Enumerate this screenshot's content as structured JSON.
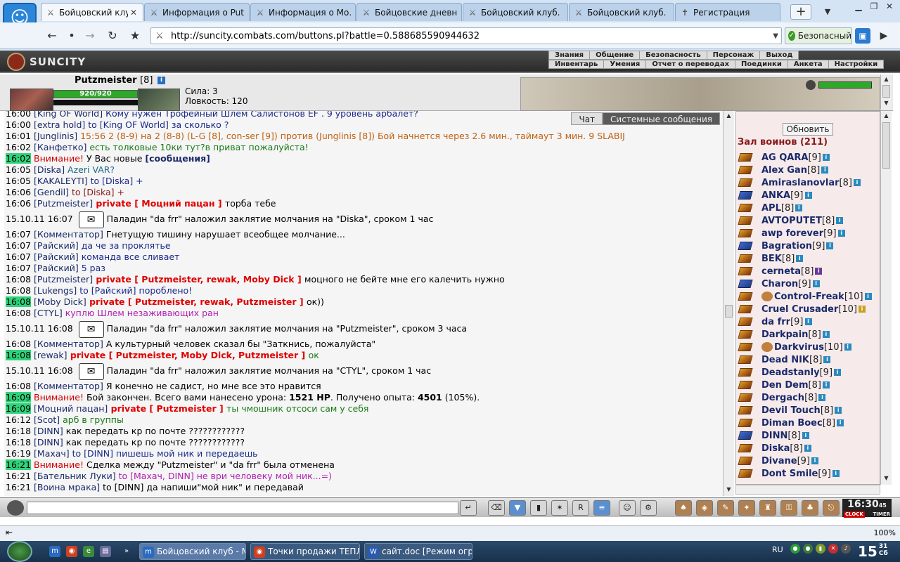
{
  "browser": {
    "tabs": [
      {
        "label": "Бойцовский клуб",
        "icon": "swords-icon",
        "active": true
      },
      {
        "label": "Информация о Put…",
        "icon": "swords-icon"
      },
      {
        "label": "Информация о Mo…",
        "icon": "swords-icon"
      },
      {
        "label": "Бойцовские дневни…",
        "icon": "swords-icon"
      },
      {
        "label": "Бойцовский клуб.",
        "icon": "swords-icon"
      },
      {
        "label": "Бойцовский клуб.",
        "icon": "swords-icon"
      },
      {
        "label": "Регистрация",
        "icon": "cross-icon"
      }
    ],
    "url": "http://suncity.combats.com/buttons.pl?battle=0.588685590944632",
    "secure_label": "Безопасный",
    "zoom": "100%"
  },
  "game": {
    "logo": "SUNCITY",
    "menu_row1": [
      "Знания",
      "Общение",
      "Безопасность",
      "Персонаж",
      "Выход"
    ],
    "menu_row2": [
      "Инвентарь",
      "Умения",
      "Отчет о переводах",
      "Поединки",
      "Анкета",
      "Настройки"
    ],
    "character": {
      "name": "Putzmeister",
      "level": "[8]",
      "hp": "920/920",
      "hp_fraction": 1.0,
      "stat1": "Сила: 3",
      "stat2": "Ловкость: 120"
    }
  },
  "chat": {
    "tabs": [
      "Чат",
      "Системные сообщения"
    ],
    "lines": [
      {
        "ts": "16:00",
        "parts": [
          [
            "nick",
            "[King OF World]"
          ],
          [
            "msg-blue",
            " Кому нужен Трофейный Шлем Салистонов EF . 9 уровень арбалет?"
          ]
        ]
      },
      {
        "ts": "16:00",
        "parts": [
          [
            "nick",
            "[extra hold]"
          ],
          [
            "msg-blue",
            " to [King OF World] за сколько ?"
          ]
        ]
      },
      {
        "ts": "16:01",
        "parts": [
          [
            "nick",
            "[Junglinis]"
          ],
          [
            "msg-orange",
            " 15:56 2 (8-9) на 2 (8-8) (L-G [8], con-ser [9]) против (Junglinis [8]) Бой начнется через 2.6 мин., таймаут 3 мин. 9 SLABIJ"
          ]
        ]
      },
      {
        "ts": "16:02",
        "parts": [
          [
            "nick",
            "[Канфетко]"
          ],
          [
            "msg-green",
            " есть толковые 10ки тут?в приват пожалуйста!"
          ]
        ]
      },
      {
        "ts": "16:02",
        "hl": true,
        "parts": [
          [
            "warn",
            "Внимание!"
          ],
          [
            "msg-dark",
            " У Вас новые "
          ],
          [
            "nick bold",
            "[сообщения]"
          ]
        ]
      },
      {
        "ts": "16:05",
        "parts": [
          [
            "nick",
            "[Diska]"
          ],
          [
            "msg-teal",
            " Azeri VAR?"
          ]
        ]
      },
      {
        "ts": "16:05",
        "parts": [
          [
            "nick",
            "[KAKALEYTI]"
          ],
          [
            "msg-blue",
            " to [Diska] +"
          ]
        ]
      },
      {
        "ts": "16:06",
        "parts": [
          [
            "nick",
            "[Gendil]"
          ],
          [
            "msg-maroon",
            " to [Diska] +"
          ]
        ]
      },
      {
        "ts": "16:06",
        "parts": [
          [
            "nick",
            "[Putzmeister]"
          ],
          [
            "private",
            " private [ Моцний пацан ] "
          ],
          [
            "msg-dark",
            "торба тебе"
          ]
        ]
      },
      {
        "ts": "15.10.11 16:07",
        "scroll": true,
        "parts": [
          [
            "msg-dark",
            "Паладин \"da frr\" наложил заклятие молчания на \"Diska\", сроком 1 час"
          ]
        ]
      },
      {
        "ts": "16:07",
        "parts": [
          [
            "nick",
            "[Комментатор]"
          ],
          [
            "msg-dark",
            " Гнетущую тишину нарушает всеобщее молчание..."
          ]
        ]
      },
      {
        "ts": "16:07",
        "parts": [
          [
            "nick",
            "[Райский]"
          ],
          [
            "msg-blue",
            " да че за проклятье"
          ]
        ]
      },
      {
        "ts": "16:07",
        "parts": [
          [
            "nick",
            "[Райский]"
          ],
          [
            "msg-blue",
            " команда все сливает"
          ]
        ]
      },
      {
        "ts": "16:07",
        "parts": [
          [
            "nick",
            "[Райский]"
          ],
          [
            "msg-blue",
            " 5 раз"
          ]
        ]
      },
      {
        "ts": "16:08",
        "parts": [
          [
            "nick",
            "[Putzmeister]"
          ],
          [
            "private",
            " private [ Putzmeister, rewak, Moby Dick ] "
          ],
          [
            "msg-dark",
            "моцного не бейте мне его калечить нужно"
          ]
        ]
      },
      {
        "ts": "16:08",
        "parts": [
          [
            "nick",
            "[Lukengs]"
          ],
          [
            "msg-blue",
            " to [Райский] пороблено!"
          ]
        ]
      },
      {
        "ts": "16:08",
        "hl": true,
        "parts": [
          [
            "nick",
            "[Moby Dick]"
          ],
          [
            "private",
            " private [ Putzmeister, rewak, Putzmeister ] "
          ],
          [
            "msg-dark",
            "ок))"
          ]
        ]
      },
      {
        "ts": "16:08",
        "parts": [
          [
            "nick",
            "[CTYL]"
          ],
          [
            "msg-purple",
            " куплю Шлем незаживающих ран"
          ]
        ]
      },
      {
        "ts": "15.10.11 16:08",
        "scroll": true,
        "parts": [
          [
            "msg-dark",
            "Паладин \"da frr\" наложил заклятие молчания на \"Putzmeister\", сроком 3 часа"
          ]
        ]
      },
      {
        "ts": "16:08",
        "parts": [
          [
            "nick",
            "[Комментатор]"
          ],
          [
            "msg-dark",
            " А культурный человек сказал бы \"Заткнись, пожалуйста\""
          ]
        ]
      },
      {
        "ts": "16:08",
        "hl": true,
        "parts": [
          [
            "nick",
            "[rewak]"
          ],
          [
            "private",
            " private [ Putzmeister, Moby Dick, Putzmeister ] "
          ],
          [
            "msg-green",
            "ок"
          ]
        ]
      },
      {
        "ts": "15.10.11 16:08",
        "scroll": true,
        "parts": [
          [
            "msg-dark",
            "Паладин \"da frr\" наложил заклятие молчания на \"CTYL\", сроком 1 час"
          ]
        ]
      },
      {
        "ts": "16:08",
        "parts": [
          [
            "nick",
            "[Комментатор]"
          ],
          [
            "msg-dark",
            " Я конечно не садист, но мне все это нравится"
          ]
        ]
      },
      {
        "ts": "16:09",
        "hl": true,
        "parts": [
          [
            "warn",
            "Внимание!"
          ],
          [
            "msg-dark",
            " Бой закончен. Всего вами нанесено урона: "
          ],
          [
            "msg-dark bold",
            "1521 HP"
          ],
          [
            "msg-dark",
            ". Получено опыта: "
          ],
          [
            "msg-dark bold",
            "4501"
          ],
          [
            "msg-dark",
            " (105%)."
          ]
        ]
      },
      {
        "ts": "16:09",
        "hl": true,
        "parts": [
          [
            "nick",
            "[Моцний пацан]"
          ],
          [
            "private",
            " private [ Putzmeister ] "
          ],
          [
            "msg-green",
            "ты чмошник отсоси сам у себя"
          ]
        ]
      },
      {
        "ts": "16:12",
        "parts": [
          [
            "nick",
            "[Scot]"
          ],
          [
            "msg-green",
            " арб в группы"
          ]
        ]
      },
      {
        "ts": "16:18",
        "parts": [
          [
            "nick",
            "[DINN]"
          ],
          [
            "msg-dark",
            " как передать кр по почте ????????????"
          ]
        ]
      },
      {
        "ts": "16:18",
        "parts": [
          [
            "nick",
            "[DINN]"
          ],
          [
            "msg-dark",
            " как передать кр по почте ????????????"
          ]
        ]
      },
      {
        "ts": "16:19",
        "parts": [
          [
            "nick",
            "[Махач]"
          ],
          [
            "msg-blue",
            " to [DINN] пишешь мой ник и передаешь"
          ]
        ]
      },
      {
        "ts": "16:21",
        "hl": true,
        "parts": [
          [
            "warn",
            "Внимание!"
          ],
          [
            "msg-dark",
            " Сделка между \"Putzmeister\" и \"da frr\" была отменена"
          ]
        ]
      },
      {
        "ts": "16:21",
        "parts": [
          [
            "nick",
            "[Бательник Луки]"
          ],
          [
            "msg-purple",
            " to [Махач, DINN] не ври человеку мой ник...=)"
          ]
        ]
      },
      {
        "ts": "16:21",
        "parts": [
          [
            "nick",
            "[Воина мрака]"
          ],
          [
            "msg-dark",
            " to [DINN] да напиши\"мой ник\" и передавай"
          ]
        ]
      }
    ]
  },
  "warriors": {
    "refresh_label": "Обновить",
    "title": "Зал воинов (211)",
    "players": [
      {
        "name": "AG QARA",
        "lvl": "[9]",
        "icon": "gold"
      },
      {
        "name": "Alex Gan",
        "lvl": "[8]",
        "icon": "gold"
      },
      {
        "name": "Amiraslanovlar",
        "lvl": "[8]",
        "icon": "gold"
      },
      {
        "name": "ANKA",
        "lvl": "[9]",
        "icon": "blue"
      },
      {
        "name": "APL",
        "lvl": "[8]",
        "icon": "gold"
      },
      {
        "name": "AVTOPUTET",
        "lvl": "[8]",
        "icon": "gold"
      },
      {
        "name": "awp forever",
        "lvl": "[9]",
        "icon": "gold"
      },
      {
        "name": "Bagration",
        "lvl": "[9]",
        "icon": "blue"
      },
      {
        "name": "BEK",
        "lvl": "[8]",
        "icon": "gold"
      },
      {
        "name": "cerneta",
        "lvl": "[8]",
        "icon": "gold",
        "info": "purple"
      },
      {
        "name": "Charon",
        "lvl": "[9]",
        "icon": "blue"
      },
      {
        "name": "Control-Freak",
        "lvl": "[10]",
        "icon": "gold",
        "badge": true
      },
      {
        "name": "Cruel Crusader",
        "lvl": "[10]",
        "icon": "gold",
        "info": "gold"
      },
      {
        "name": "da frr",
        "lvl": "[9]",
        "icon": "gold"
      },
      {
        "name": "Darkpain",
        "lvl": "[8]",
        "icon": "gold"
      },
      {
        "name": "Darkvirus",
        "lvl": "[10]",
        "icon": "gold",
        "badge": true
      },
      {
        "name": "Dead NIK",
        "lvl": "[8]",
        "icon": "gold"
      },
      {
        "name": "Deadstanly",
        "lvl": "[9]",
        "icon": "gold"
      },
      {
        "name": "Den Dem",
        "lvl": "[8]",
        "icon": "gold"
      },
      {
        "name": "Dergach",
        "lvl": "[8]",
        "icon": "gold"
      },
      {
        "name": "Devil Touch",
        "lvl": "[8]",
        "icon": "gold"
      },
      {
        "name": "Diman Boec",
        "lvl": "[8]",
        "icon": "gold"
      },
      {
        "name": "DINN",
        "lvl": "[8]",
        "icon": "blue"
      },
      {
        "name": "Diska",
        "lvl": "[8]",
        "icon": "gold"
      },
      {
        "name": "Divane",
        "lvl": "[9]",
        "icon": "gold"
      },
      {
        "name": "Dont Smile",
        "lvl": "[9]",
        "icon": "gold"
      }
    ]
  },
  "clock": {
    "time": "16:30",
    "suffix": "45",
    "labels": [
      "CLOCK",
      "TIMER"
    ]
  },
  "taskbar": {
    "tasks": [
      "Бойцовский клуб - M…",
      "Точки продажи ТЕПЛ…",
      "сайт.doc [Режим огр…"
    ],
    "lang": "RU",
    "time": "15",
    "time_small": "31",
    "day": "Сб"
  }
}
